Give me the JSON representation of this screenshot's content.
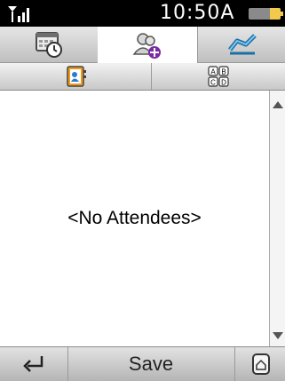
{
  "status": {
    "time": "10:50A",
    "signal_icon": "signal-icon",
    "battery_icon": "battery-icon"
  },
  "tabs": [
    {
      "icon": "calendar-clock-icon"
    },
    {
      "icon": "attendees-add-icon",
      "active": true
    },
    {
      "icon": "sync-icon"
    }
  ],
  "subtabs": [
    {
      "icon": "address-book-icon"
    },
    {
      "icon": "abcd-sort-icon",
      "letters": [
        "A",
        "B",
        "C",
        "D"
      ]
    }
  ],
  "content": {
    "empty_text": "<No Attendees>"
  },
  "bottom": {
    "save_label": "Save",
    "back_icon": "back-arrow-icon",
    "home_icon": "home-icon"
  }
}
